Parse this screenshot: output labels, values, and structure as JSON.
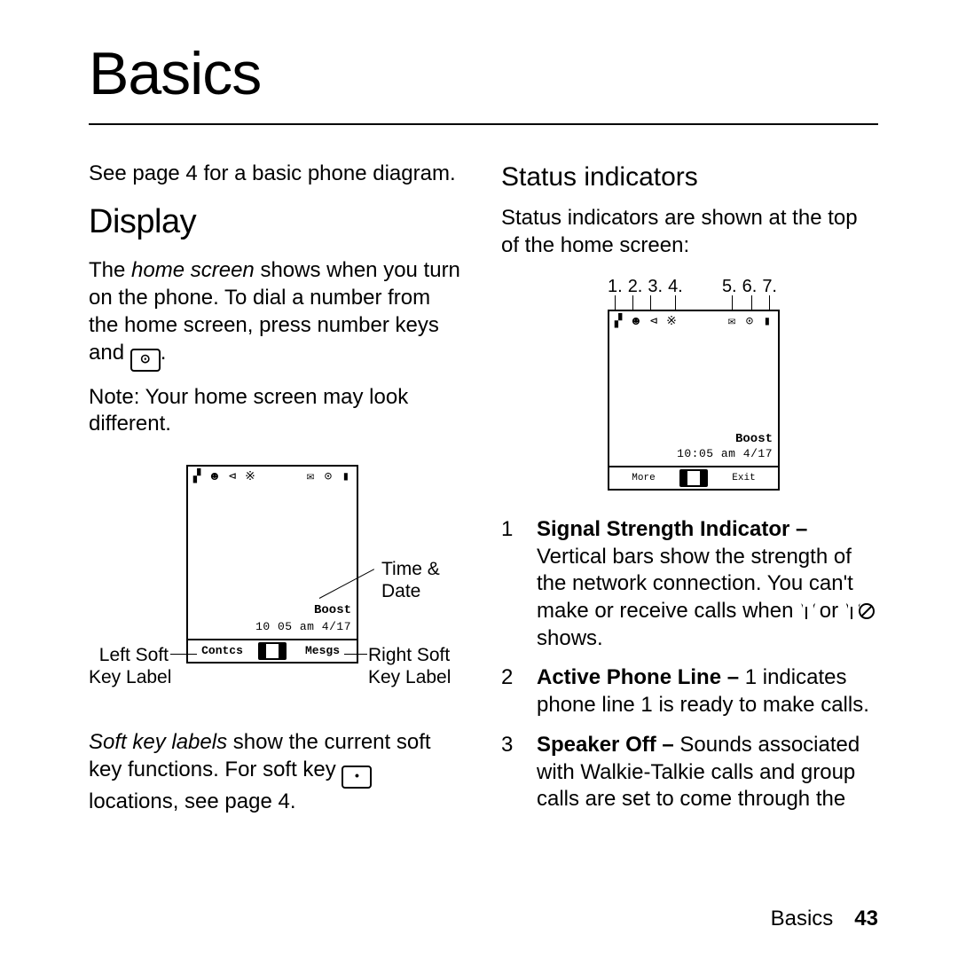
{
  "chapter_title": "Basics",
  "intro_line": "See page 4 for a basic phone diagram.",
  "display": {
    "heading": "Display",
    "para1_a": "The ",
    "para1_italic": "home screen",
    "para1_b": " shows when you turn on the phone. To dial a number from the home screen, press number keys and ",
    "para1_key": "⊙",
    "para1_c": ".",
    "note": "Note: Your home screen may look different.",
    "diagram": {
      "status_icons_left": [
        "▞",
        "☻",
        "⊲",
        "※"
      ],
      "status_icons_right": [
        "✉",
        "⊙",
        "▮"
      ],
      "brand": "Boost",
      "time_date": "10 05 am  4/17",
      "soft_left": "Contcs",
      "soft_right": "Mesgs",
      "callout_time": "Time &\nDate",
      "callout_leftsoft": "Left Soft\nKey Label",
      "callout_rightsoft": "Right Soft\nKey Label"
    },
    "para2_a": "Soft key labels",
    "para2_b": " show the current soft key functions. For soft key ",
    "para2_key": "•",
    "para2_c": " locations, see page 4."
  },
  "status": {
    "heading": "Status indicators",
    "intro": "Status indicators are shown at the top of the home screen:",
    "diagram": {
      "key_left": [
        "1.",
        "2.",
        "3.",
        "4."
      ],
      "key_right": [
        "5.",
        "6.",
        "7."
      ],
      "status_icons_left": [
        "▞",
        "☻",
        "⊲",
        "※"
      ],
      "status_icons_right": [
        "✉",
        "⊙",
        "▮"
      ],
      "brand": "Boost",
      "time_date": "10:05 am  4/17",
      "soft_left": "More",
      "soft_right": "Exit"
    },
    "items": [
      {
        "num": "1",
        "title": "Signal Strength Indicator –",
        "body_a": " Vertical bars show the strength of the network connection. You can't make or receive calls when ",
        "body_b": " or ",
        "body_c": " shows."
      },
      {
        "num": "2",
        "title": "Active Phone Line –",
        "body": " 1 indicates phone line 1 is ready to make calls."
      },
      {
        "num": "3",
        "title": "Speaker Off –",
        "body": " Sounds associated with Walkie-Talkie calls and group calls are set to come through the"
      }
    ]
  },
  "footer": {
    "section": "Basics",
    "page": "43"
  }
}
